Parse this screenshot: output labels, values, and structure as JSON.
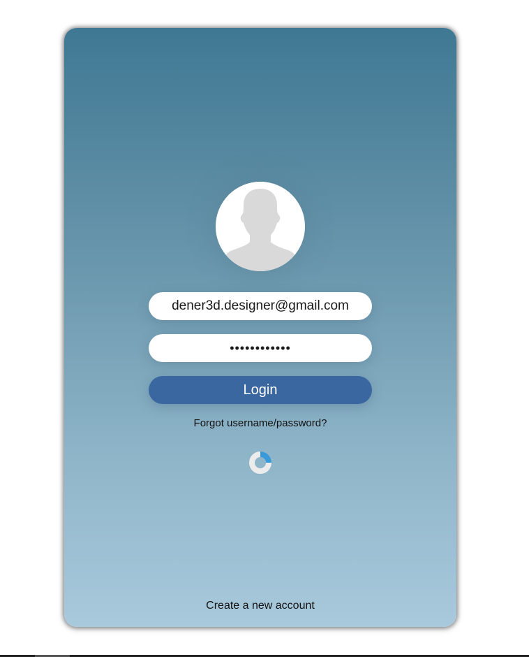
{
  "login": {
    "email_value": "dener3d.designer@gmail.com",
    "password_value": "••••••••••••",
    "login_label": "Login",
    "forgot_label": "Forgot username/password?",
    "create_label": "Create a new account"
  },
  "icons": {
    "avatar": "user-silhouette-icon",
    "spinner": "loading-spinner-icon"
  },
  "colors": {
    "card_top": "#3f7893",
    "card_bottom": "#a9c9dc",
    "button": "#3a67a0",
    "spinner_accent": "#3a9ad9"
  }
}
